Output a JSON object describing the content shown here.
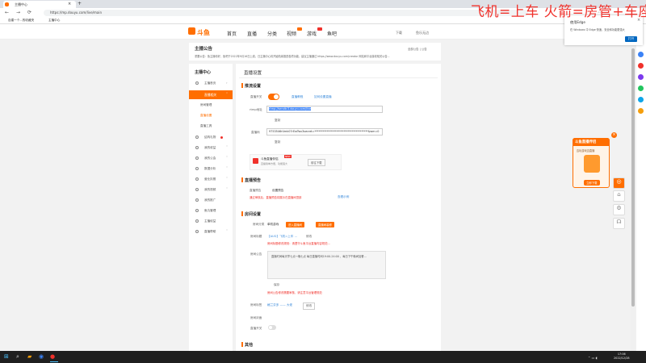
{
  "browser": {
    "tab_title": "主播中心",
    "url": "https://mp.douyu.com/live/main",
    "bookmarks": [
      "自建一个...的收藏夹",
      "主播中心"
    ]
  },
  "overlay_text": "飞机=上车 火箭=房管+车座",
  "site": {
    "logo_text": "斗鱼",
    "nav": [
      "首页",
      "直播",
      "分类",
      "视频",
      "游戏",
      "鱼吧"
    ],
    "nav_right": "下载",
    "user": "鱼乐无边"
  },
  "notice": {
    "title": "主播公告",
    "text": "重要公告：鱼主播你好，鱼吧于2022年9月16日上线，日主播中心将开始陆续推进各项功能，建议主播通过 https://www.douyu.com/creator 网站和平台接收相关公告...",
    "right": "全部公告 | 公告"
  },
  "sidebar": {
    "title": "主播中心",
    "items": [
      {
        "label": "主播首页",
        "icon": "home-icon"
      },
      {
        "label": "直播相关",
        "icon": "camera-icon",
        "active": true
      },
      {
        "label": "房间管理",
        "sub": true
      },
      {
        "label": "直播设置",
        "sub": true,
        "highlight": true
      },
      {
        "label": "直播工具",
        "sub": true
      },
      {
        "label": "结构礼物",
        "icon": "gift-icon"
      },
      {
        "label": "我的收益",
        "icon": "wallet-icon"
      },
      {
        "label": "我的公会",
        "icon": "group-icon"
      },
      {
        "label": "数据分析",
        "icon": "chart-icon"
      },
      {
        "label": "营业执照",
        "icon": "license-icon"
      },
      {
        "label": "我的视频",
        "icon": "video-icon"
      },
      {
        "label": "我的推广",
        "icon": "promo-icon"
      },
      {
        "label": "鱼丸管理",
        "icon": "manage-icon"
      },
      {
        "label": "主播权益",
        "icon": "rights-icon"
      },
      {
        "label": "直播帮助",
        "icon": "help-icon"
      }
    ]
  },
  "main": {
    "title": "直播设置",
    "stream": {
      "heading": "推流设置",
      "toggle_label": "直播开关",
      "links": [
        "直播教程",
        "如何设置直播"
      ],
      "rtmp_label": "rtmp地址",
      "rtmp_value": "rtmp://sendtc3.douyu.com/live",
      "copy": "复制",
      "code_label": "直播码",
      "code_value": "9753546rUmk07rEwTwv3secret=***************************************&wm=0",
      "app_title": "斗鱼直播伴侣",
      "app_sub": "直播简单方便，功能强大",
      "app_badge": "NEW",
      "app_btn": "前往下载"
    },
    "preview": {
      "heading": "直播预告",
      "label": "直播预告",
      "value": "设置预告",
      "warn": "通过审核后，直播预告将展示在直播间顶部",
      "link": "查看示例"
    },
    "room": {
      "heading": "房间设置",
      "cat_label": "房间分类",
      "cat_value": "单机游戏",
      "btn1": "进入直播间",
      "btn2": "直播间装修",
      "title_label": "房间标题",
      "title_value": "【AUG】飞机=上车 ...",
      "edit": "修改",
      "title_warn": "房间标题修改规则：请遵守斗鱼平台直播内容规范...",
      "notice_label": "房间公告",
      "notice_value": "直播时间每天早七点～晚七点 每日直播时间19:00-24:00 ，每日下午晚间加餐...",
      "save": "保存",
      "notice_warn": "房间公告修改需要审核，请注意平台管理规范",
      "tag_label": "房间标签",
      "tag_value": "格兰芬多 —— 大佬",
      "tag_btn": "修改",
      "cover_label": "房间封面",
      "hide_label": "直播开关"
    },
    "other_heading": "其他"
  },
  "edge_popup": {
    "title": "使用Edge",
    "text": "在 Windows 中 Edge 快速，安全和功能更强大",
    "btn": "打开"
  },
  "promo": {
    "title": "斗鱼直播伴侣",
    "sub": "边玩游戏边直播",
    "btn": "立即下载"
  },
  "clock": {
    "time": "17:06",
    "date": "2022/12/28"
  }
}
